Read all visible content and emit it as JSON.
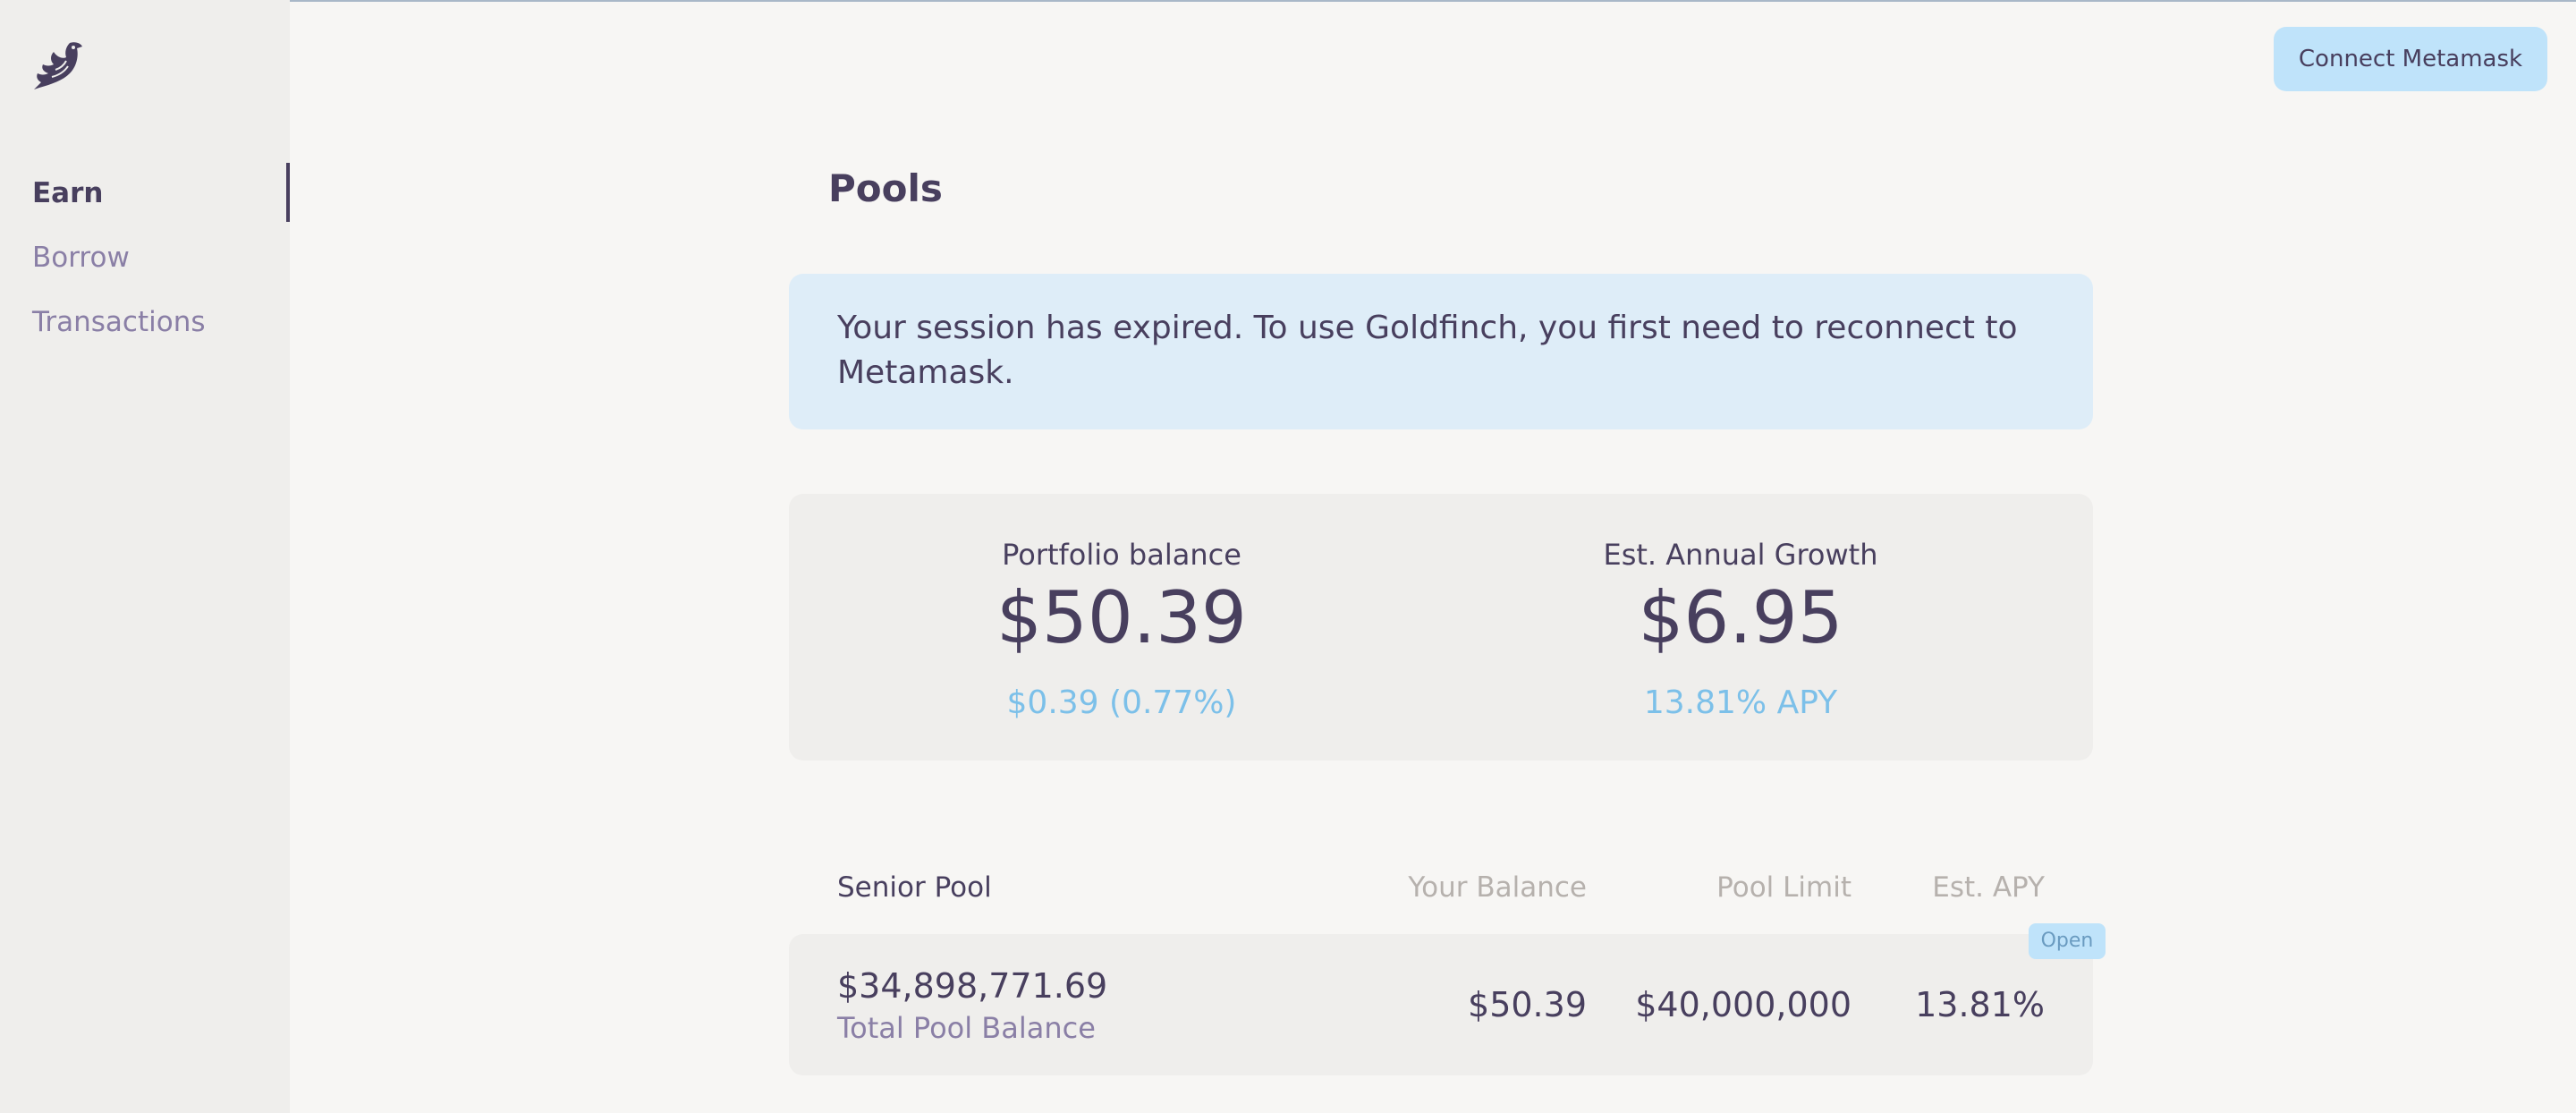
{
  "header": {
    "connect_label": "Connect Metamask"
  },
  "sidebar": {
    "logo_icon": "goldfinch-bird-icon",
    "items": [
      {
        "label": "Earn",
        "active": true
      },
      {
        "label": "Borrow",
        "active": false
      },
      {
        "label": "Transactions",
        "active": false
      }
    ]
  },
  "main": {
    "title": "Pools",
    "notice": "Your session has expired. To use Goldfinch, you first need to reconnect to Metamask.",
    "portfolio": {
      "balance_label": "Portfolio balance",
      "balance_value": "$50.39",
      "balance_change": "$0.39 (0.77%)",
      "growth_label": "Est. Annual Growth",
      "growth_value": "$6.95",
      "growth_apy": "13.81% APY"
    },
    "table": {
      "headers": [
        "Senior Pool",
        "Your Balance",
        "Pool Limit",
        "Est. APY"
      ],
      "rows": [
        {
          "total": "$34,898,771.69",
          "total_label": "Total Pool Balance",
          "your_balance": "$50.39",
          "pool_limit": "$40,000,000",
          "est_apy": "13.81%",
          "badge": "Open"
        }
      ]
    }
  },
  "colors": {
    "accent": "#7cc0e9",
    "text": "#483f5e",
    "muted": "#8a7fa6",
    "button": "#bfe3fa",
    "notice_bg": "#deedf8"
  }
}
